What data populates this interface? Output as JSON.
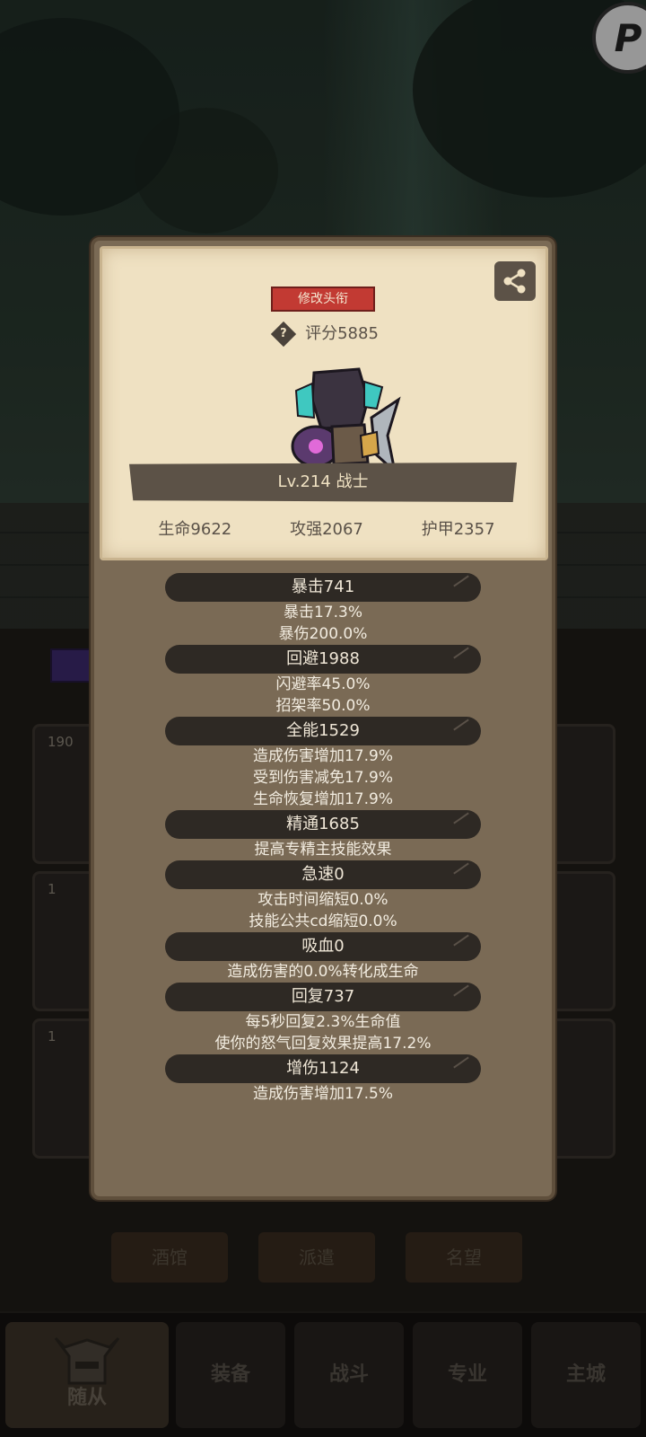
{
  "background": {
    "slots": [
      {
        "num": "190"
      },
      {
        "num": "1"
      },
      {
        "num": "1"
      }
    ],
    "mini_tabs": [
      "酒馆",
      "派遣",
      "名望"
    ],
    "nav": [
      {
        "label": "随从",
        "active": true
      },
      {
        "label": "装备"
      },
      {
        "label": "战斗"
      },
      {
        "label": "专业"
      },
      {
        "label": "主城"
      }
    ],
    "corner_letter": "P"
  },
  "card": {
    "title_button": "修改头衔",
    "score": "评分5885",
    "level_class": "Lv.214 战士",
    "stats": [
      "生命9622",
      "攻强2067",
      "护甲2357"
    ]
  },
  "attributes": [
    {
      "head": "暴击741",
      "lines": [
        "暴击17.3%",
        "暴伤200.0%"
      ]
    },
    {
      "head": "回避1988",
      "lines": [
        "闪避率45.0%",
        "招架率50.0%"
      ]
    },
    {
      "head": "全能1529",
      "lines": [
        "造成伤害增加17.9%",
        "受到伤害减免17.9%",
        "生命恢复增加17.9%"
      ]
    },
    {
      "head": "精通1685",
      "lines": [
        "提高专精主技能效果"
      ]
    },
    {
      "head": "急速0",
      "lines": [
        "攻击时间缩短0.0%",
        "技能公共cd缩短0.0%"
      ]
    },
    {
      "head": "吸血0",
      "lines": [
        "造成伤害的0.0%转化成生命"
      ]
    },
    {
      "head": "回复737",
      "lines": [
        "每5秒回复2.3%生命值",
        "使你的怒气回复效果提高17.2%"
      ]
    },
    {
      "head": "增伤1124",
      "lines": [
        "造成伤害增加17.5%"
      ]
    }
  ],
  "colors": {
    "title_button": "#c23a33",
    "card_bg": "#efe1c2",
    "panel_bg": "#7a6a55",
    "header_pill": "#2e2924"
  }
}
